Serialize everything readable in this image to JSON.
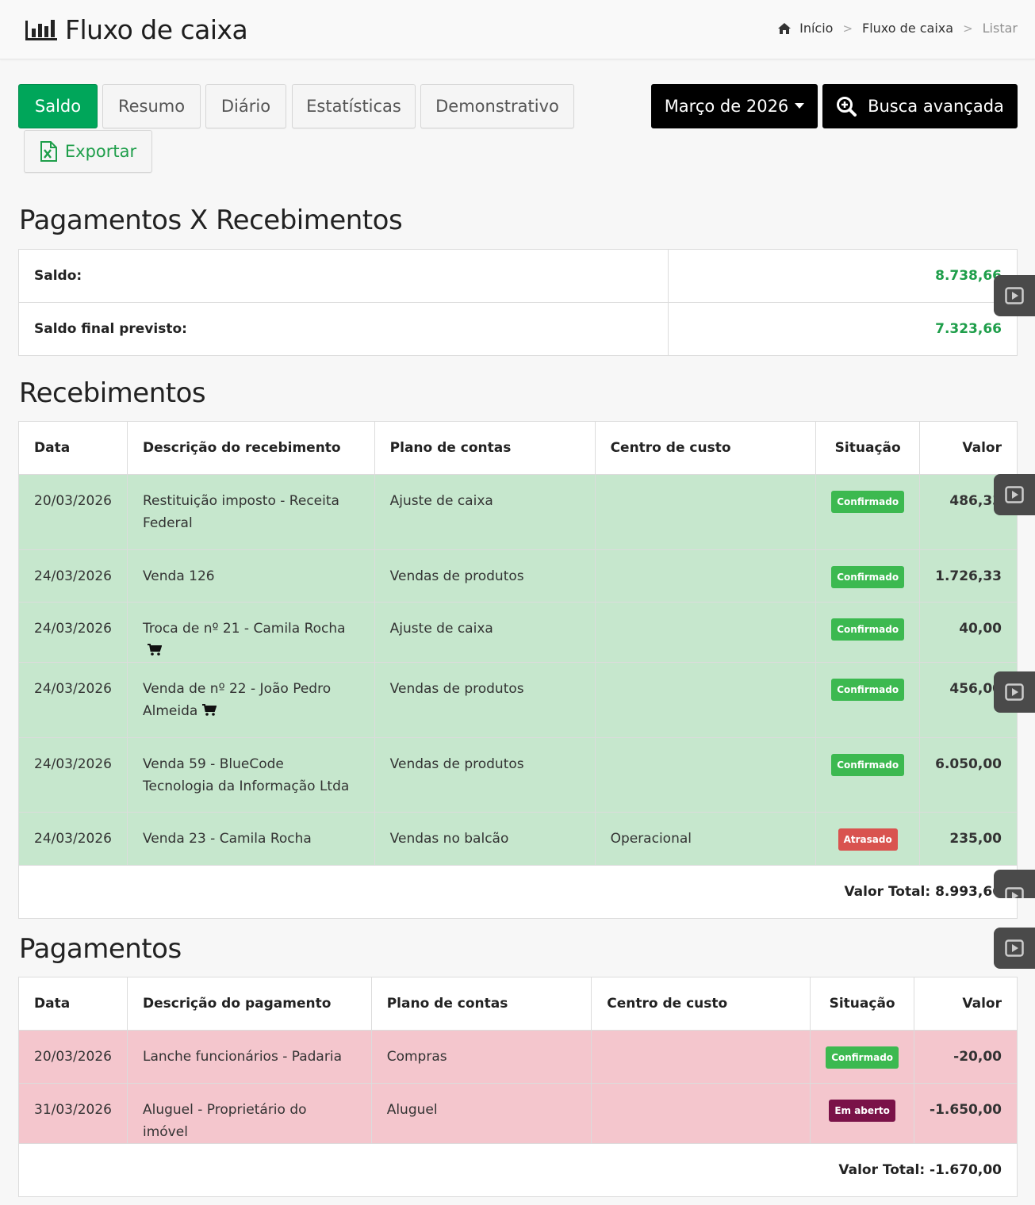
{
  "header": {
    "title": "Fluxo de caixa",
    "breadcrumb": {
      "home": "Início",
      "section": "Fluxo de caixa",
      "current": "Listar",
      "separator": ">"
    }
  },
  "tabs": {
    "saldo": "Saldo",
    "resumo": "Resumo",
    "diario": "Diário",
    "estatisticas": "Estatísticas",
    "demonstrativo": "Demonstrativo",
    "exportar": "Exportar"
  },
  "actions": {
    "period": "Março de 2026",
    "advanced_search": "Busca avançada"
  },
  "summary": {
    "title": "Pagamentos X Recebimentos",
    "rows": [
      {
        "label": "Saldo:",
        "value": "8.738,66"
      },
      {
        "label": "Saldo final previsto:",
        "value": "7.323,66"
      }
    ]
  },
  "receipts": {
    "title": "Recebimentos",
    "columns": {
      "date": "Data",
      "description": "Descrição do recebimento",
      "account_plan": "Plano de contas",
      "cost_center": "Centro de custo",
      "status": "Situação",
      "value": "Valor"
    },
    "rows": [
      {
        "date": "20/03/2026",
        "description": "Restituição imposto - Receita Federal",
        "account_plan": "Ajuste de caixa",
        "cost_center": "",
        "status": "Confirmado",
        "value": "486,33"
      },
      {
        "date": "24/03/2026",
        "description": "Venda 126",
        "account_plan": "Vendas de produtos",
        "cost_center": "",
        "status": "Confirmado",
        "value": "1.726,33"
      },
      {
        "date": "24/03/2026",
        "description": "Troca de nº 21 - Camila Rocha",
        "account_plan": "Ajuste de caixa",
        "cost_center": "",
        "status": "Confirmado",
        "value": "40,00"
      },
      {
        "date": "24/03/2026",
        "description": "Venda de nº 22 - João Pedro Almeida",
        "account_plan": "Vendas de produtos",
        "cost_center": "",
        "status": "Confirmado",
        "value": "456,00"
      },
      {
        "date": "24/03/2026",
        "description": "Venda 59 - BlueCode Tecnologia da Informação Ltda",
        "account_plan": "Vendas de produtos",
        "cost_center": "",
        "status": "Confirmado",
        "value": "6.050,00"
      },
      {
        "date": "24/03/2026",
        "description": "Venda 23 - Camila Rocha",
        "account_plan": "Vendas no balcão",
        "cost_center": "Operacional",
        "status": "Atrasado",
        "value": "235,00"
      }
    ],
    "total": "Valor Total: 8.993,66"
  },
  "payments": {
    "title": "Pagamentos",
    "columns": {
      "date": "Data",
      "description": "Descrição do pagamento",
      "account_plan": "Plano de contas",
      "cost_center": "Centro de custo",
      "status": "Situação",
      "value": "Valor"
    },
    "rows": [
      {
        "date": "20/03/2026",
        "description": "Lanche funcionários - Padaria",
        "account_plan": "Compras",
        "cost_center": "",
        "status": "Confirmado",
        "value": "-20,00"
      },
      {
        "date": "31/03/2026",
        "description": "Aluguel - Proprietário do imóvel",
        "account_plan": "Aluguel",
        "cost_center": "",
        "status": "Em aberto",
        "value": "-1.650,00"
      }
    ],
    "total": "Valor Total: -1.670,00"
  },
  "colors": {
    "green_button": "#00a65a",
    "receipt_row": "#c6e7cd",
    "payment_row": "#f4c6cd",
    "badge_confirmed": "#3cb950",
    "badge_late": "#d9534f",
    "badge_open": "#7a1248"
  }
}
